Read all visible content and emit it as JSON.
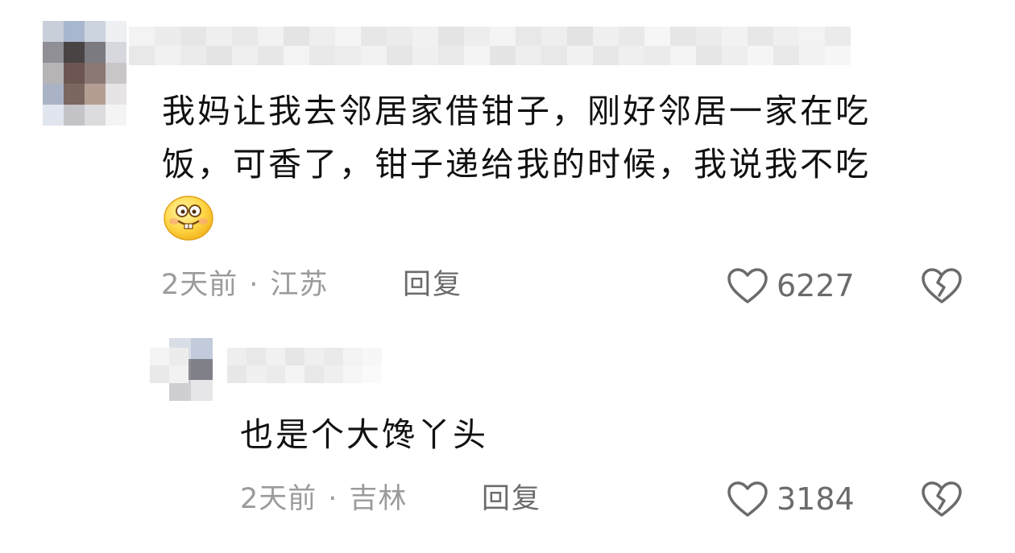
{
  "comments": [
    {
      "text_line1": "我妈让我去邻居家借钳子，刚好邻居一家在吃",
      "text_line2": "饭，可香了，钳子递给我的时候，我说我不吃",
      "emoji": "drooling-smile-emoji",
      "time": "2天前",
      "separator": "·",
      "location": "江苏",
      "reply_label": "回复",
      "likes": "6227"
    },
    {
      "text_line1": "也是个大馋丫头",
      "time": "2天前",
      "separator": "·",
      "location": "吉林",
      "reply_label": "回复",
      "likes": "3184"
    }
  ],
  "icons": {
    "like": "heart-outline-icon",
    "dislike": "broken-heart-icon"
  },
  "colors": {
    "text": "#111111",
    "meta": "#9b9b9b",
    "action": "#6b6b6b"
  }
}
